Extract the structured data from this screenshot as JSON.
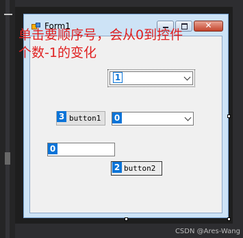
{
  "form": {
    "title": "Form1"
  },
  "caption_buttons": {
    "close": "✕"
  },
  "note": "单击要顺序号，会从0到控件个数-1的变化",
  "controls": {
    "combo_top": {
      "tab_index": "1"
    },
    "button1": {
      "label": "button1",
      "tab_index": "3"
    },
    "combo_mid": {
      "tab_index": "0"
    },
    "textbox": {
      "tab_index": "0"
    },
    "button2": {
      "label": "button2",
      "tab_index": "2"
    }
  },
  "watermark": "CSDN @Ares-Wang"
}
